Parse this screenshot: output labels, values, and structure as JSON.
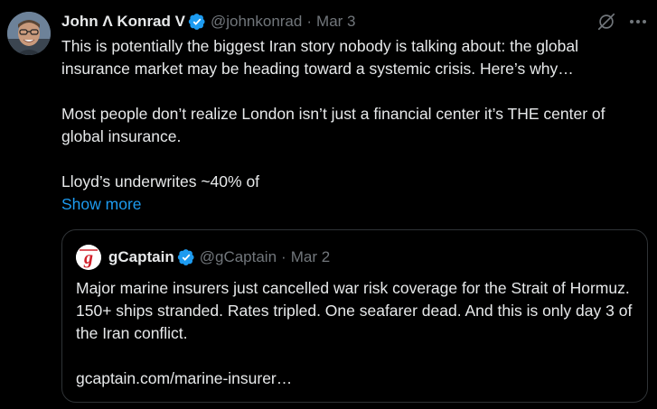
{
  "tweet": {
    "author": {
      "name": "John Λ Konrad V",
      "handle": "@johnkonrad",
      "verified": true
    },
    "date": "Mar 3",
    "separator": "·",
    "paragraphs": [
      "This is potentially the biggest Iran story nobody is talking about: the global insurance market may be heading toward a systemic crisis. Here’s why…",
      "Most people don’t realize London isn’t just a financial center it’s THE center of global insurance.",
      "Lloyd’s underwrites ~40% of"
    ],
    "show_more_label": "Show more",
    "icons": {
      "grok": "grok-icon",
      "more": "more-options-icon",
      "verified": "verified-badge-icon"
    }
  },
  "quote": {
    "author": {
      "name": "gCaptain",
      "handle": "@gCaptain",
      "verified": true,
      "logo_letter": "g"
    },
    "date": "Mar 2",
    "separator": "·",
    "paragraphs": [
      "Major marine insurers just cancelled war risk coverage for the Strait of Hormuz. 150+ ships stranded. Rates tripled. One seafarer dead. And this is only day 3 of the Iran conflict.",
      "gcaptain.com/marine-insurer…"
    ]
  },
  "colors": {
    "background": "#000000",
    "text": "#e7e9ea",
    "secondary": "#71767b",
    "link": "#1d9bf0",
    "border": "#2f3336",
    "verified": "#1d9bf0",
    "gcaptain_red": "#d0202a"
  }
}
